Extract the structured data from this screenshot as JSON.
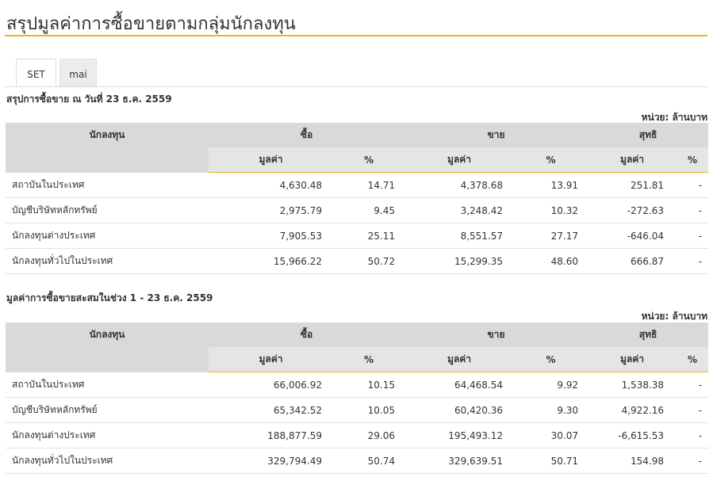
{
  "page_title": "สรุปมูลค่าการซื้อขายตามกลุ่มนักลงทุน",
  "tabs": [
    {
      "label": "SET",
      "active": true
    },
    {
      "label": "mai",
      "active": false
    }
  ],
  "unit_label": "หน่วย: ล้านบาท",
  "columns": {
    "investor": "นักลงทุน",
    "buy": "ซื้อ",
    "sell": "ขาย",
    "net": "สุทธิ",
    "value": "มูลค่า",
    "percent": "%"
  },
  "daily": {
    "title": "สรุปการซื้อขาย ณ วันที่ 23 ธ.ค. 2559",
    "rows": [
      {
        "investor": "สถาบันในประเทศ",
        "buy_value": "4,630.48",
        "buy_pct": "14.71",
        "sell_value": "4,378.68",
        "sell_pct": "13.91",
        "net_value": "251.81",
        "net_pct": "-",
        "net_sign": "pos"
      },
      {
        "investor": "บัญชีบริษัทหลักทรัพย์",
        "buy_value": "2,975.79",
        "buy_pct": "9.45",
        "sell_value": "3,248.42",
        "sell_pct": "10.32",
        "net_value": "-272.63",
        "net_pct": "-",
        "net_sign": "neg"
      },
      {
        "investor": "นักลงทุนต่างประเทศ",
        "buy_value": "7,905.53",
        "buy_pct": "25.11",
        "sell_value": "8,551.57",
        "sell_pct": "27.17",
        "net_value": "-646.04",
        "net_pct": "-",
        "net_sign": "neg"
      },
      {
        "investor": "นักลงทุนทั่วไปในประเทศ",
        "buy_value": "15,966.22",
        "buy_pct": "50.72",
        "sell_value": "15,299.35",
        "sell_pct": "48.60",
        "net_value": "666.87",
        "net_pct": "-",
        "net_sign": "pos"
      }
    ]
  },
  "cumulative": {
    "title": "มูลค่าการซื้อขายสะสมในช่วง 1 - 23 ธ.ค. 2559",
    "rows": [
      {
        "investor": "สถาบันในประเทศ",
        "buy_value": "66,006.92",
        "buy_pct": "10.15",
        "sell_value": "64,468.54",
        "sell_pct": "9.92",
        "net_value": "1,538.38",
        "net_pct": "-",
        "net_sign": "pos"
      },
      {
        "investor": "บัญชีบริษัทหลักทรัพย์",
        "buy_value": "65,342.52",
        "buy_pct": "10.05",
        "sell_value": "60,420.36",
        "sell_pct": "9.30",
        "net_value": "4,922.16",
        "net_pct": "-",
        "net_sign": "pos"
      },
      {
        "investor": "นักลงทุนต่างประเทศ",
        "buy_value": "188,877.59",
        "buy_pct": "29.06",
        "sell_value": "195,493.12",
        "sell_pct": "30.07",
        "net_value": "-6,615.53",
        "net_pct": "-",
        "net_sign": "neg"
      },
      {
        "investor": "นักลงทุนทั่วไปในประเทศ",
        "buy_value": "329,794.49",
        "buy_pct": "50.74",
        "sell_value": "329,639.51",
        "sell_pct": "50.71",
        "net_value": "154.98",
        "net_pct": "-",
        "net_sign": "pos"
      }
    ]
  },
  "colors": {
    "accent": "#f0b323",
    "header_bg": "#d9d9d9",
    "positive": "#2a8a2a",
    "negative": "#e0242c"
  }
}
